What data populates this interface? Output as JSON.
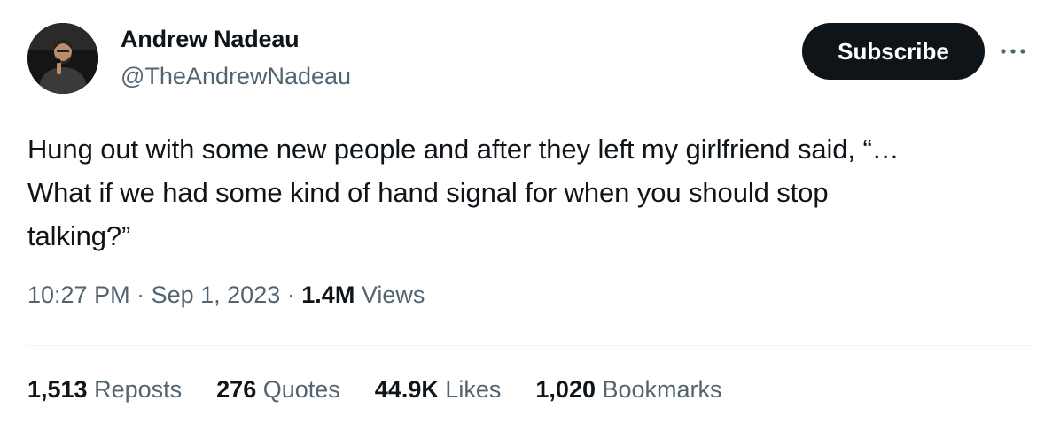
{
  "author": {
    "display_name": "Andrew Nadeau",
    "handle": "@TheAndrewNadeau",
    "avatar": "avatar-photo"
  },
  "header": {
    "subscribe_label": "Subscribe",
    "more_icon": "more-horizontal-icon"
  },
  "tweet": {
    "text_lines": [
      "Hung out with some new people and after they left my girlfriend said, “…",
      "What if we had some kind of hand signal for when you should stop",
      "talking?”"
    ]
  },
  "meta": {
    "time": "10:27 PM",
    "separator": "·",
    "date": "Sep 1, 2023",
    "views_count": "1.4M",
    "views_label": "Views"
  },
  "stats": [
    {
      "count": "1,513",
      "label": "Reposts"
    },
    {
      "count": "276",
      "label": "Quotes"
    },
    {
      "count": "44.9K",
      "label": "Likes"
    },
    {
      "count": "1,020",
      "label": "Bookmarks"
    }
  ],
  "colors": {
    "text_primary": "#0f1419",
    "text_secondary": "#536471",
    "button_bg": "#0f1419",
    "divider": "#eff3f4"
  }
}
